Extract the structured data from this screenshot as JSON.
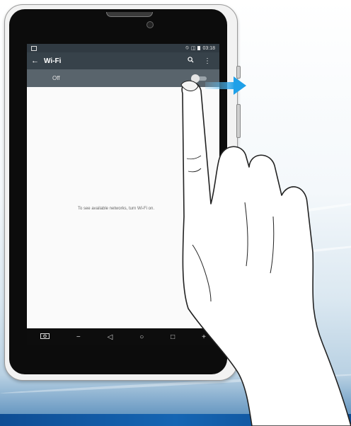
{
  "statusbar": {
    "time": "03:18"
  },
  "appbar": {
    "title": "Wi-Fi",
    "back_icon": "arrow-left-icon",
    "search_icon": "search-icon",
    "menu_icon": "more-vert-icon"
  },
  "wifi_toggle": {
    "label": "Off",
    "state": "off"
  },
  "hint_text": "To see available networks, turn Wi-Fi on.",
  "navbar": {
    "buttons": [
      "screenshot-icon",
      "volume-down-icon",
      "back-icon",
      "home-icon",
      "recents-icon",
      "volume-up-icon"
    ]
  },
  "colors": {
    "appbar": "#37424a",
    "toggle_row": "#59646c",
    "arrow": "#2aa4e6",
    "footer": "#1565b3"
  }
}
